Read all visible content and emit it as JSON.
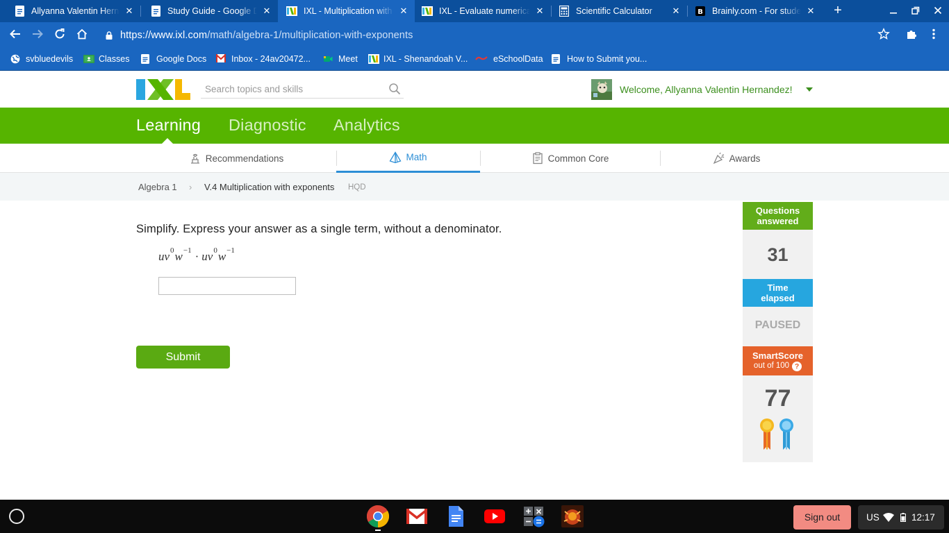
{
  "browser": {
    "tabs": [
      {
        "title": "Allyanna Valentin Herna"
      },
      {
        "title": "Study Guide - Google Do"
      },
      {
        "title": "IXL - Multiplication with e"
      },
      {
        "title": "IXL - Evaluate numerical"
      },
      {
        "title": "Scientific Calculator"
      },
      {
        "title": "Brainly.com - For studen"
      }
    ],
    "url_host": "https://www.ixl.com",
    "url_path": "/math/algebra-1/multiplication-with-exponents",
    "bookmarks": [
      {
        "label": "svbluedevils"
      },
      {
        "label": "Classes"
      },
      {
        "label": "Google Docs"
      },
      {
        "label": "Inbox - 24av20472..."
      },
      {
        "label": "Meet"
      },
      {
        "label": "IXL - Shenandoah V..."
      },
      {
        "label": "eSchoolData"
      },
      {
        "label": "How to Submit you..."
      }
    ],
    "new_tab_label": "+",
    "close_glyph": "✕"
  },
  "ixl": {
    "search_placeholder": "Search topics and skills",
    "welcome": "Welcome, Allyanna Valentin Hernandez!",
    "main_nav": [
      {
        "label": "Learning"
      },
      {
        "label": "Diagnostic"
      },
      {
        "label": "Analytics"
      }
    ],
    "sub_nav": [
      {
        "label": "Recommendations"
      },
      {
        "label": "Math"
      },
      {
        "label": "Common Core"
      },
      {
        "label": "Awards"
      }
    ],
    "breadcrumb": {
      "parent": "Algebra 1",
      "separator": "›",
      "current": "V.4 Multiplication with exponents",
      "code": "HQD"
    },
    "question": {
      "prompt": "Simplify. Express your answer as a single term, without a denominator.",
      "expression": {
        "b1": "u",
        "b2": "v",
        "e2": "0",
        "b3": "w",
        "e3": "−1",
        "dot": "·",
        "b4": "u",
        "b5": "v",
        "e5": "0",
        "b6": "w",
        "e6": "−1"
      },
      "answer_value": "",
      "submit_label": "Submit"
    },
    "stats": {
      "questions_label_1": "Questions",
      "questions_label_2": "answered",
      "questions_value": "31",
      "time_label_1": "Time",
      "time_label_2": "elapsed",
      "time_value": "PAUSED",
      "smartscore_label": "SmartScore",
      "smartscore_sub": "out of 100",
      "help_glyph": "?",
      "smartscore_value": "77"
    },
    "colors": {
      "green": "#56b400",
      "blue": "#26a6df",
      "orange": "#e5622b",
      "link_green": "#3c8f1e"
    }
  },
  "shelf": {
    "sign_out": "Sign out",
    "lang": "US",
    "time": "12:17"
  }
}
